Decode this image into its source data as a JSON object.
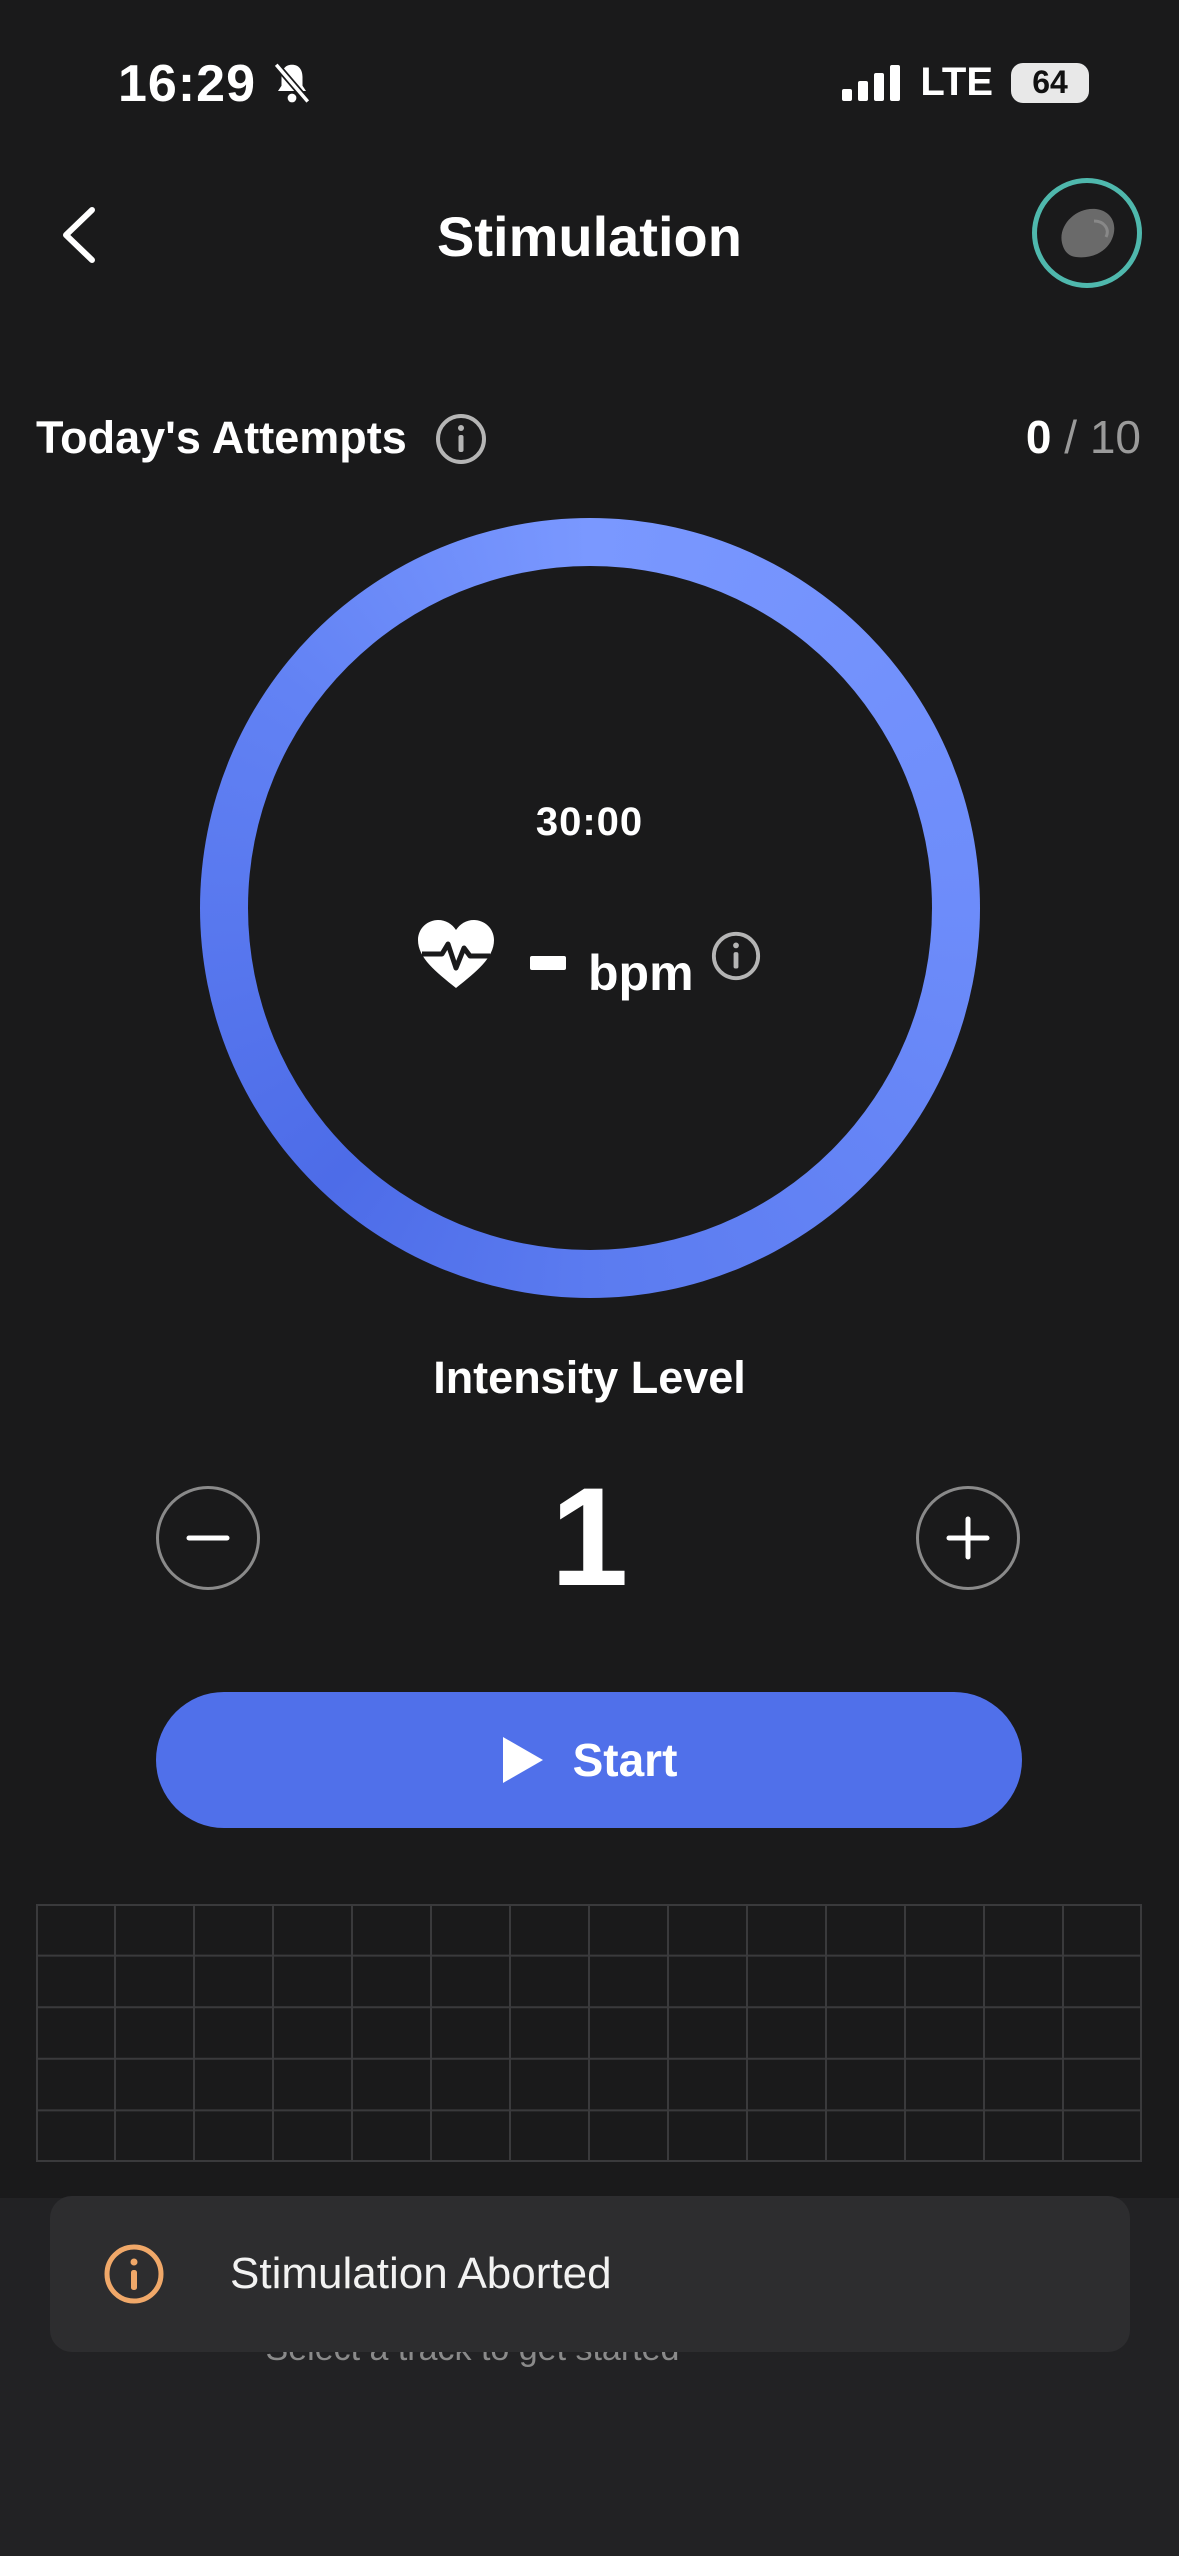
{
  "status_bar": {
    "time": "16:29",
    "network": "LTE",
    "battery": "64"
  },
  "header": {
    "title": "Stimulation"
  },
  "attempts": {
    "label": "Today's Attempts",
    "current": "0",
    "separator": " / ",
    "total": "10"
  },
  "session": {
    "timer": "30:00",
    "bpm_value": "-",
    "bpm_unit": "bpm"
  },
  "intensity": {
    "label": "Intensity Level",
    "value": "1"
  },
  "start_button": {
    "label": "Start"
  },
  "grid": {
    "rows": 5,
    "cols": 14
  },
  "sheet": {
    "hint": "Select a track to get started"
  },
  "toast": {
    "message": "Stimulation Aborted"
  },
  "colors": {
    "accent": "#5070ea",
    "ring_light": "#7a98ff",
    "avatar_ring": "#4fb8ad",
    "toast_icon": "#f0a869",
    "background": "#1a1a1b"
  },
  "icons": [
    "muted-bell-icon",
    "signal-icon",
    "back-chevron-icon",
    "device-avatar-icon",
    "info-icon",
    "heart-rate-icon",
    "minus-icon",
    "plus-icon",
    "play-icon"
  ]
}
